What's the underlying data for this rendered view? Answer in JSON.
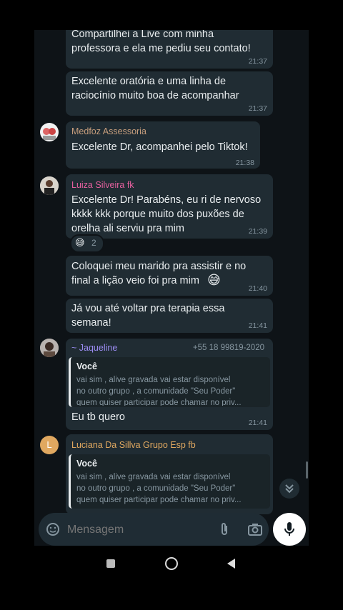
{
  "messages": {
    "m1": {
      "text": "Compartilhei a Live com minha\nprofessora e ela me pediu seu contato!",
      "time": "21:37"
    },
    "m2": {
      "text": "Excelente oratória e uma linha de\nraciocínio muito boa de acompanhar",
      "time": "21:37"
    },
    "m3": {
      "sender": "Medfoz Assessoria",
      "text": "Excelente Dr, acompanhei pelo Tiktok!",
      "time": "21:38"
    },
    "m4": {
      "sender": "Luiza Silveira fk",
      "text": "Excelente Dr! Parabéns, eu ri de nervoso\nkkkk kkk porque muito dos puxões de\norelha ali serviu pra mim",
      "time": "21:39",
      "reaction_emoji": "😅",
      "reaction_count": "2"
    },
    "m5": {
      "text": "Coloquei meu marido pra assistir e no\nfinal a lição veio foi pra mim",
      "emoji": "😅",
      "time": "21:40"
    },
    "m6": {
      "text": "Já vou até voltar pra terapia essa\nsemana!",
      "time": "21:41"
    },
    "m7": {
      "sender": "~ Jaqueline",
      "phone": "+55 18 99819-2020",
      "quote_author": "Você",
      "quote_text": "vai sim , alive gravada vai estar disponível\nno outro grupo , a comunidade \"Seu Poder\"\nquem quiser participar pode chamar no priv...",
      "text": "Eu tb quero",
      "time": "21:41"
    },
    "m8": {
      "sender": "Luciana Da Sillva Grupo Esp fb",
      "avatar_letter": "L",
      "quote_author": "Você",
      "quote_text": "vai sim , alive gravada vai estar disponível\nno outro grupo , a comunidade \"Seu Poder\"\nquem quiser participar pode chamar no priv..."
    }
  },
  "composer": {
    "placeholder": "Mensagem"
  },
  "colors": {
    "medfoz": "#c79e7d",
    "luiza": "#e5609f",
    "jaqueline": "#9b8cf2",
    "luciana": "#e0a860",
    "bubble": "#202c33"
  }
}
